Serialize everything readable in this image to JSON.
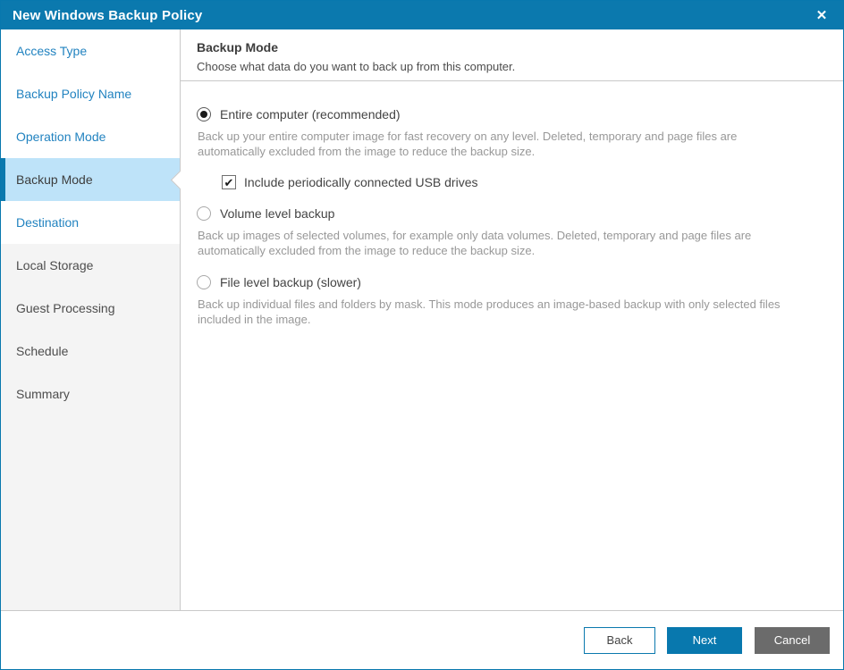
{
  "window": {
    "title": "New Windows Backup Policy"
  },
  "icons": {
    "close": "✕",
    "check": "✔"
  },
  "colors": {
    "titlebar_blue": "#0b79ae",
    "link_blue": "#2283c0",
    "selected_item_bg": "#bee3f9",
    "sidebar_future_bg": "#f4f4f4",
    "border_gray": "#c9c9c9",
    "text_dark": "#444444",
    "text_description_gray": "#989898",
    "next_button_blue": "#0878ae",
    "cancel_button_gray": "#6b6b6b"
  },
  "sidebar": {
    "items": [
      {
        "label": "Access Type",
        "state": "visited"
      },
      {
        "label": "Backup Policy Name",
        "state": "visited"
      },
      {
        "label": "Operation Mode",
        "state": "visited"
      },
      {
        "label": "Backup Mode",
        "state": "selected"
      },
      {
        "label": "Destination",
        "state": "visited"
      },
      {
        "label": "Local Storage",
        "state": "future"
      },
      {
        "label": "Guest Processing",
        "state": "future"
      },
      {
        "label": "Schedule",
        "state": "future"
      },
      {
        "label": "Summary",
        "state": "future"
      }
    ]
  },
  "header": {
    "title": "Backup Mode",
    "subtitle": "Choose what data do you want to back up from this computer."
  },
  "options": [
    {
      "label": "Entire computer (recommended)",
      "selected": true,
      "description": "Back up your entire computer image for fast recovery on any level. Deleted, temporary and page files are automatically excluded from the image to reduce the backup size.",
      "checkbox": {
        "label": "Include periodically connected USB drives",
        "checked": true
      }
    },
    {
      "label": "Volume level backup",
      "selected": false,
      "description": "Back up images of selected volumes, for example only data volumes. Deleted, temporary and page files are automatically excluded from the image to reduce the backup size."
    },
    {
      "label": "File level backup (slower)",
      "selected": false,
      "description": "Back up individual files and folders by mask. This mode produces an image-based backup with only selected files included in the image."
    }
  ],
  "footer": {
    "back_label": "Back",
    "next_label": "Next",
    "cancel_label": "Cancel"
  }
}
